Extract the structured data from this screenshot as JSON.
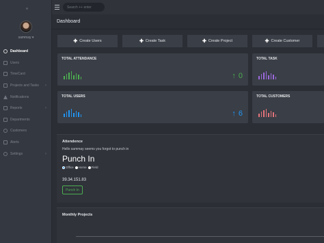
{
  "search": {
    "placeholder": "Search ++ enter"
  },
  "sidebar": {
    "username": "sammay",
    "items": [
      {
        "label": "Dashboard",
        "icon": "dashboard-icon"
      },
      {
        "label": "Users",
        "icon": "users-icon"
      },
      {
        "label": "TimeCard",
        "icon": "timecard-icon"
      },
      {
        "label": "Projects and Tasks",
        "icon": "projects-icon"
      },
      {
        "label": "Notifications",
        "icon": "bell-icon"
      },
      {
        "label": "Reports",
        "icon": "reports-icon"
      },
      {
        "label": "Departments",
        "icon": "departments-icon"
      },
      {
        "label": "Customers",
        "icon": "customers-icon"
      },
      {
        "label": "Alerts",
        "icon": "alerts-icon"
      },
      {
        "label": "Settings",
        "icon": "settings-icon"
      }
    ]
  },
  "breadcrumb": {
    "title": "Dashboard"
  },
  "actions": {
    "create_users": "Create Users",
    "create_task": "Create Task",
    "create_project": "Create Project",
    "create_customer": "Create Customer"
  },
  "cards": {
    "total_attendance": {
      "title": "TOTAL ATTENDANCE",
      "value": "0",
      "color": "#4caf50"
    },
    "total_task": {
      "title": "TOTAL TASK",
      "color": "#9c6ade"
    },
    "total_users": {
      "title": "TOTAL USERS",
      "value": "6",
      "color": "#2196f3"
    },
    "total_customers": {
      "title": "TOTAL CUSTOMERS",
      "color": "#e5737b"
    }
  },
  "attendance": {
    "title": "Attendence",
    "message": "Hello sammay seems you forgot to punch in",
    "heading": "Punch In",
    "options": [
      "Office",
      "Home",
      "Field"
    ],
    "selected": "Office",
    "ip": "39.34.151.83",
    "button": "Punch In"
  },
  "monthly": {
    "title": "Monthly Projects"
  }
}
